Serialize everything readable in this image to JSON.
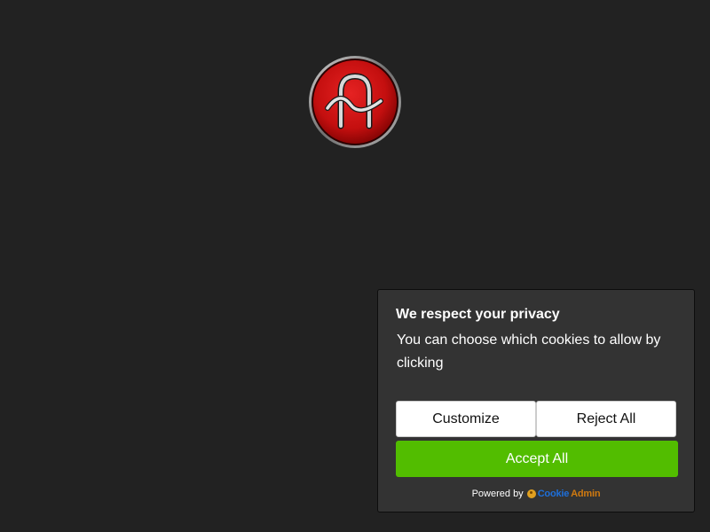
{
  "logo": {
    "icon": "ah-monogram-logo-icon",
    "colors": {
      "disc": "#cc1111",
      "ring": "#8a8a8a",
      "glyph": "#d8d8d8"
    }
  },
  "cookie": {
    "title": "We respect your privacy",
    "text": "You can choose which cookies to allow by clicking",
    "customize_label": "Customize",
    "reject_label": "Reject All",
    "accept_label": "Accept All",
    "powered_by": "Powered by",
    "brand_part1": "Cookie",
    "brand_part2": "Admin"
  },
  "colors": {
    "background": "#222222",
    "banner": "#333333",
    "accept": "#52bd00"
  }
}
